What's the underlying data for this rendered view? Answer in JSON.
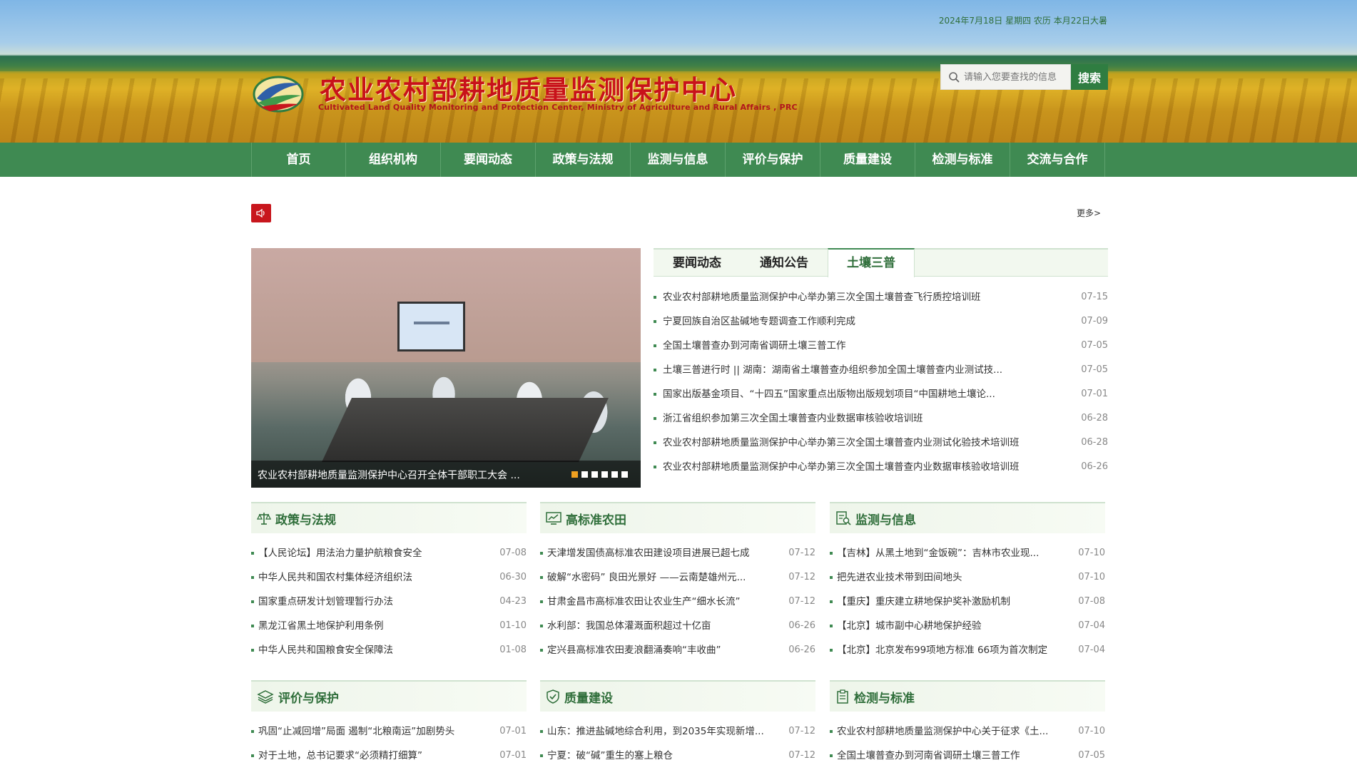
{
  "header": {
    "date": "2024年7月18日 星期四 农历 本月22日大暑",
    "title": "农业农村部耕地质量监测保护中心",
    "subtitle": "Cultivated Land Quality Monitoring and Protection Center, Ministry of Agriculture and Rural Affairs , PRC",
    "search_placeholder": "请输入您要查找的信息",
    "search_button": "搜索"
  },
  "nav": [
    "首页",
    "组织机构",
    "要闻动态",
    "政策与法规",
    "监测与信息",
    "评价与保护",
    "质量建设",
    "检测与标准",
    "交流与合作"
  ],
  "notice": {
    "more": "更多>"
  },
  "slider": {
    "caption": "农业农村部耕地质量监测保护中心召开全体干部职工大会 ...",
    "dot_count": 6,
    "active_dot": 0
  },
  "tabnews": {
    "tabs": [
      "要闻动态",
      "通知公告",
      "土壤三普"
    ],
    "active_tab": 2,
    "items": [
      {
        "title": "农业农村部耕地质量监测保护中心举办第三次全国土壤普查飞行质控培训班",
        "date": "07-15"
      },
      {
        "title": "宁夏回族自治区盐碱地专题调查工作顺利完成",
        "date": "07-09"
      },
      {
        "title": "全国土壤普查办到河南省调研土壤三普工作",
        "date": "07-05"
      },
      {
        "title": "土壤三普进行时 || 湖南：湖南省土壤普查办组织参加全国土壤普查内业测试技...",
        "date": "07-05"
      },
      {
        "title": "国家出版基金项目、“十四五”国家重点出版物出版规划项目“中国耕地土壤论...",
        "date": "07-01"
      },
      {
        "title": "浙江省组织参加第三次全国土壤普查内业数据审核验收培训班",
        "date": "06-28"
      },
      {
        "title": "农业农村部耕地质量监测保护中心举办第三次全国土壤普查内业测试化验技术培训班",
        "date": "06-28"
      },
      {
        "title": "农业农村部耕地质量监测保护中心举办第三次全国土壤普查内业数据审核验收培训班",
        "date": "06-26"
      }
    ]
  },
  "columns": [
    {
      "title": "政策与法规",
      "icon": "scale-icon",
      "items": [
        {
          "title": "【人民论坛】用法治力量护航粮食安全",
          "date": "07-08"
        },
        {
          "title": "中华人民共和国农村集体经济组织法",
          "date": "06-30"
        },
        {
          "title": "国家重点研发计划管理暂行办法",
          "date": "04-23"
        },
        {
          "title": "黑龙江省黑土地保护利用条例",
          "date": "01-10"
        },
        {
          "title": "中华人民共和国粮食安全保障法",
          "date": "01-08"
        }
      ]
    },
    {
      "title": "高标准农田",
      "icon": "chart-monitor-icon",
      "items": [
        {
          "title": "天津增发国债高标准农田建设项目进展已超七成",
          "date": "07-12"
        },
        {
          "title": "破解“水密码”   良田光景好 ——云南楚雄州元...",
          "date": "07-12"
        },
        {
          "title": "甘肃金昌市高标准农田让农业生产“细水长流”",
          "date": "07-12"
        },
        {
          "title": "水利部：我国总体灌溉面积超过十亿亩",
          "date": "06-26"
        },
        {
          "title": "定兴县高标准农田麦浪翻涌奏响“丰收曲”",
          "date": "06-26"
        }
      ]
    },
    {
      "title": "监测与信息",
      "icon": "document-search-icon",
      "items": [
        {
          "title": "【吉林】从黑土地到“金饭碗”：吉林市农业现...",
          "date": "07-10"
        },
        {
          "title": "把先进农业技术带到田间地头",
          "date": "07-10"
        },
        {
          "title": "【重庆】重庆建立耕地保护奖补激励机制",
          "date": "07-08"
        },
        {
          "title": "【北京】城市副中心耕地保护经验",
          "date": "07-04"
        },
        {
          "title": "【北京】北京发布99项地方标准 66项为首次制定",
          "date": "07-04"
        }
      ]
    },
    {
      "title": "评价与保护",
      "icon": "layers-icon",
      "items": [
        {
          "title": "巩固“止减回增”局面 遏制“北粮南运”加剧势头",
          "date": "07-01"
        },
        {
          "title": "对于土地，总书记要求“必须精打细算”",
          "date": "07-01"
        }
      ]
    },
    {
      "title": "质量建设",
      "icon": "shield-check-icon",
      "items": [
        {
          "title": "山东：推进盐碱地综合利用，到2035年实现新增...",
          "date": "07-12"
        },
        {
          "title": "宁夏：破“碱”重生的塞上粮仓",
          "date": "07-12"
        }
      ]
    },
    {
      "title": "检测与标准",
      "icon": "clipboard-icon",
      "items": [
        {
          "title": "农业农村部耕地质量监测保护中心关于征求《土...",
          "date": "07-10"
        },
        {
          "title": "全国土壤普查办到河南省调研土壤三普工作",
          "date": "07-05"
        }
      ]
    }
  ]
}
